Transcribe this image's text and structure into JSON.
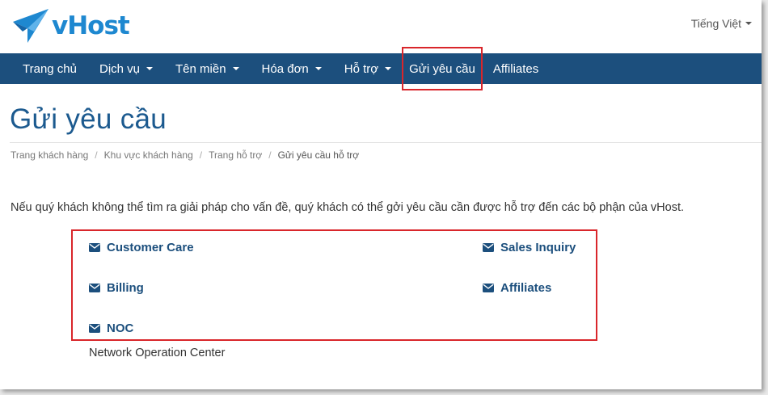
{
  "header": {
    "logo_text": "vHost",
    "language": "Tiếng Việt"
  },
  "nav": {
    "items": [
      {
        "label": "Trang chủ",
        "dropdown": false
      },
      {
        "label": "Dịch vụ",
        "dropdown": true
      },
      {
        "label": "Tên miền",
        "dropdown": true
      },
      {
        "label": "Hóa đơn",
        "dropdown": true
      },
      {
        "label": "Hỗ trợ",
        "dropdown": true
      },
      {
        "label": "Gửi yêu cầu",
        "dropdown": false
      },
      {
        "label": "Affiliates",
        "dropdown": false
      }
    ]
  },
  "page": {
    "title": "Gửi yêu cầu",
    "breadcrumb": [
      "Trang khách hàng",
      "Khu vực khách hàng",
      "Trang hỗ trợ",
      "Gửi yêu cầu hỗ trợ"
    ],
    "intro": "Nếu quý khách không thể tìm ra giải pháp cho vấn đề, quý khách có thể gởi yêu cầu cần được hỗ trợ đến các bộ phận của vHost."
  },
  "departments": {
    "customer_care": "Customer Care",
    "sales_inquiry": "Sales Inquiry",
    "billing": "Billing",
    "affiliates": "Affiliates",
    "noc": "NOC",
    "noc_description": "Network Operation Center"
  },
  "colors": {
    "navbar": "#1c4f7d",
    "title": "#1c5a8f",
    "link": "#1c4f7d",
    "highlight": "#d9262b",
    "logo": "#1e88d0"
  }
}
